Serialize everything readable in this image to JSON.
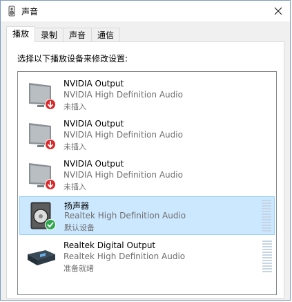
{
  "window": {
    "title": "声音",
    "close_glyph": "✕"
  },
  "tabs": [
    {
      "label": "播放",
      "active": true
    },
    {
      "label": "录制",
      "active": false
    },
    {
      "label": "声音",
      "active": false
    },
    {
      "label": "通信",
      "active": false
    }
  ],
  "instruction": "选择以下播放设备来修改设置:",
  "devices": [
    {
      "name": "NVIDIA Output",
      "description": "NVIDIA High Definition Audio",
      "status": "未插入",
      "icon": "monitor-icon",
      "badge": "unplugged-arrow-icon",
      "selected": false,
      "meter": false
    },
    {
      "name": "NVIDIA Output",
      "description": "NVIDIA High Definition Audio",
      "status": "未插入",
      "icon": "monitor-icon",
      "badge": "unplugged-arrow-icon",
      "selected": false,
      "meter": false
    },
    {
      "name": "NVIDIA Output",
      "description": "NVIDIA High Definition Audio",
      "status": "未插入",
      "icon": "monitor-icon",
      "badge": "unplugged-arrow-icon",
      "selected": false,
      "meter": false
    },
    {
      "name": "扬声器",
      "description": "Realtek High Definition Audio",
      "status": "默认设备",
      "icon": "speaker-icon",
      "badge": "default-check-icon",
      "selected": true,
      "meter": true
    },
    {
      "name": "Realtek Digital Output",
      "description": "Realtek High Definition Audio",
      "status": "准备就绪",
      "icon": "digital-output-icon",
      "badge": "",
      "selected": false,
      "meter": true
    }
  ],
  "colors": {
    "selected_bg": "#cce8ff",
    "selected_border": "#99d1ff",
    "unplugged_red": "#d92b2b",
    "default_green": "#2fa84f"
  }
}
